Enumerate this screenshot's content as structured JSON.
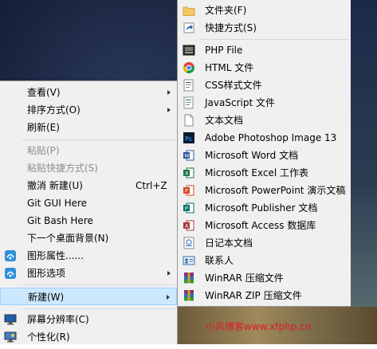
{
  "main_menu": {
    "items": [
      {
        "label": "查看(V)"
      },
      {
        "label": "排序方式(O)"
      },
      {
        "label": "刷新(E)"
      },
      {
        "label": "粘贴(P)"
      },
      {
        "label": "粘贴快捷方式(S)"
      },
      {
        "label": "撤消 新建(U)",
        "shortcut": "Ctrl+Z"
      },
      {
        "label": "Git GUI Here"
      },
      {
        "label": "Git Bash Here"
      },
      {
        "label": "下一个桌面背景(N)"
      },
      {
        "label": "图形属性......"
      },
      {
        "label": "图形选项"
      },
      {
        "label": "新建(W)"
      },
      {
        "label": "屏幕分辨率(C)"
      },
      {
        "label": "个性化(R)"
      }
    ]
  },
  "new_submenu": {
    "items": [
      {
        "label": "文件夹(F)",
        "icon": "folder-icon"
      },
      {
        "label": "快捷方式(S)",
        "icon": "shortcut-icon"
      },
      {
        "label": "PHP File",
        "icon": "php-file-icon"
      },
      {
        "label": "HTML 文件",
        "icon": "chrome-icon"
      },
      {
        "label": "CSS样式文件",
        "icon": "css-file-icon"
      },
      {
        "label": "JavaScript 文件",
        "icon": "js-file-icon"
      },
      {
        "label": "文本文档",
        "icon": "text-document-icon"
      },
      {
        "label": "Adobe Photoshop Image 13",
        "icon": "photoshop-icon"
      },
      {
        "label": "Microsoft Word 文档",
        "icon": "word-icon"
      },
      {
        "label": "Microsoft Excel 工作表",
        "icon": "excel-icon"
      },
      {
        "label": "Microsoft PowerPoint 演示文稿",
        "icon": "powerpoint-icon"
      },
      {
        "label": "Microsoft Publisher 文档",
        "icon": "publisher-icon"
      },
      {
        "label": "Microsoft Access 数据库",
        "icon": "access-icon"
      },
      {
        "label": "日记本文档",
        "icon": "journal-icon"
      },
      {
        "label": "联系人",
        "icon": "contact-icon"
      },
      {
        "label": "WinRAR 压缩文件",
        "icon": "winrar-icon"
      },
      {
        "label": "WinRAR ZIP 压缩文件",
        "icon": "winrar-zip-icon"
      }
    ]
  },
  "watermark": "小风博客www.xfphp.cn",
  "colors": {
    "menu_bg": "#f0f0f0",
    "highlight_bg": "#cce8ff",
    "highlight_border": "#99d1ff",
    "watermark": "#e0191f"
  }
}
